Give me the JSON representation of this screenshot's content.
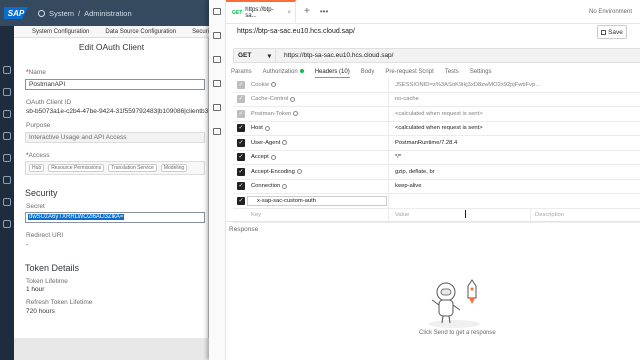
{
  "sap": {
    "logo": "SAP",
    "breadcrumb": [
      "System",
      "Administration"
    ],
    "tabs": [
      "System Configuration",
      "Data Source Configuration",
      "Securi"
    ]
  },
  "dialog": {
    "title": "Edit OAuth Client",
    "name_label": "Name",
    "name_value": "PostmanAPI",
    "client_id_label": "OAuth Client ID",
    "client_id_value": "sb-b5073a1e-c2b4-47be-9424-31f559792483|b109086|clientb365",
    "purpose_label": "Purpose",
    "purpose_value": "Interactive Usage and API Access",
    "access_label": "Access",
    "access_scopes": [
      "Hub",
      "Resource Permissions",
      "Translation Service",
      "Modeling"
    ],
    "security_heading": "Security",
    "secret_label": "Secret",
    "secret_value": "dwSUzA6yTXRRLWO2l6ALl3ZlkA=",
    "redirect_label": "Redirect URI",
    "redirect_value": "-",
    "token_heading": "Token Details",
    "token_lifetime_label": "Token Lifetime",
    "token_lifetime_value": "1 hour",
    "refresh_lifetime_label": "Refresh Token Lifetime",
    "refresh_lifetime_value": "720 hours"
  },
  "postman": {
    "tab_method": "GET",
    "tab_label": "https://btp-sa...",
    "environment": "No Environment",
    "request_name": "https://btp-sa-sac.eu10.hcs.cloud.sap/",
    "save_label": "Save",
    "method": "GET",
    "url": "https://btp-sa-sac.eu10.hcs.cloud.sap/",
    "subtabs": [
      "Params",
      "Authorization",
      "Headers (10)",
      "Body",
      "Pre-request Script",
      "Tests",
      "Settings"
    ],
    "headers": [
      {
        "key": "Cookie",
        "value": "JSESSIONID=s%3ASoK9ikj3xD8zwMO2x92pjFwbFvp...",
        "state": "dim"
      },
      {
        "key": "Cache-Control",
        "value": "no-cache",
        "state": "dim"
      },
      {
        "key": "Postman-Token",
        "value": "<calculated when request is sent>",
        "state": "dim"
      },
      {
        "key": "Host",
        "value": "<calculated when request is sent>",
        "state": "on"
      },
      {
        "key": "User-Agent",
        "value": "PostmanRuntime/7.28.4",
        "state": "on"
      },
      {
        "key": "Accept",
        "value": "*/*",
        "state": "on"
      },
      {
        "key": "Accept-Encoding",
        "value": "gzip, deflate, br",
        "state": "on"
      },
      {
        "key": "Connection",
        "value": "keep-alive",
        "state": "on"
      },
      {
        "key": "x-sap-sac-custom-auth",
        "value": "",
        "state": "on"
      }
    ],
    "new_row": {
      "key": "Key",
      "value": "Value",
      "description": "Description"
    },
    "response_label": "Response",
    "empty_hint": "Click Send to get a response"
  }
}
